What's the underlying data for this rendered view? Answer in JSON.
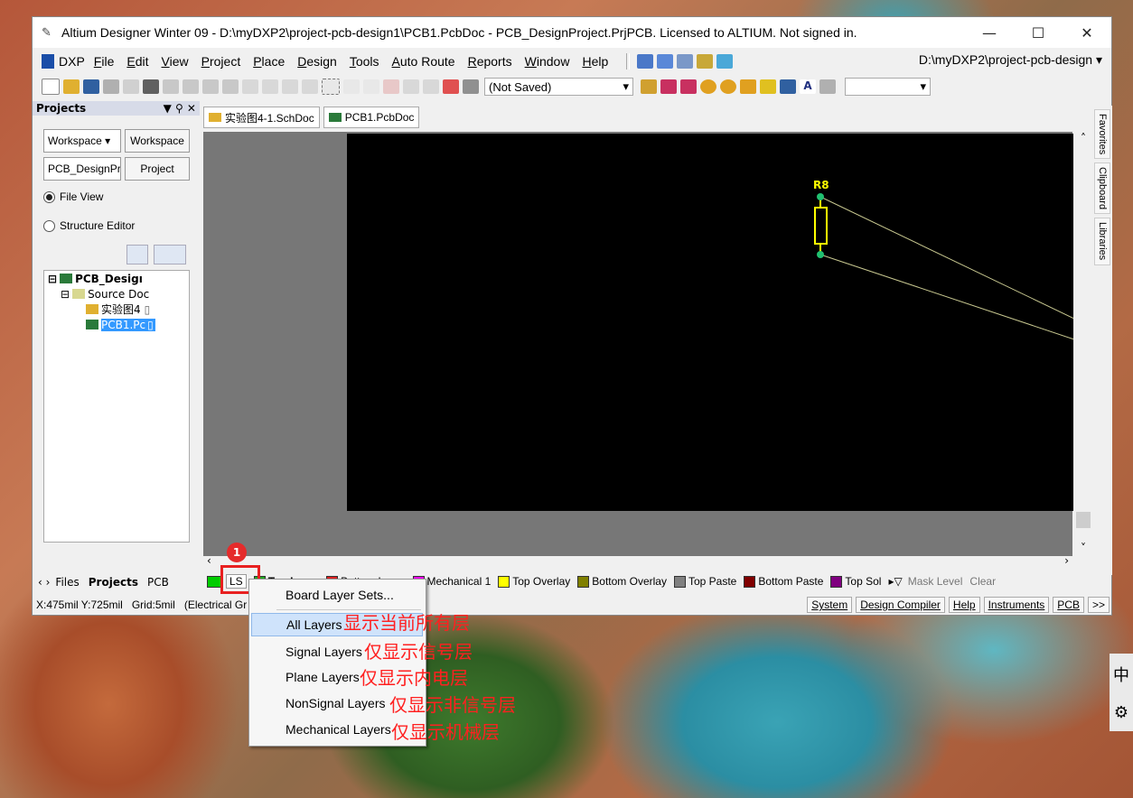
{
  "window": {
    "title": "Altium Designer Winter 09 - D:\\myDXP2\\project-pcb-design1\\PCB1.PcbDoc - PCB_DesignProject.PrjPCB. Licensed to ALTIUM. Not signed in.",
    "minimize": "—",
    "maximize": "☐",
    "close": "✕"
  },
  "menubar": {
    "dxp": "DXP",
    "items": [
      "File",
      "Edit",
      "View",
      "Project",
      "Place",
      "Design",
      "Tools",
      "Auto Route",
      "Reports",
      "Window",
      "Help"
    ],
    "path": "D:\\myDXP2\\project-pcb-design"
  },
  "toolbar": {
    "save_state": "(Not Saved)"
  },
  "projects_panel": {
    "title": "Projects",
    "workspace_combo": "Workspace",
    "workspace_button": "Workspace",
    "project_combo": "PCB_DesignPr(",
    "project_button": "Project",
    "file_view": "File View",
    "structure_editor": "Structure Editor",
    "tree": {
      "project": "PCB_Desigı",
      "source_docs": "Source Doc",
      "sch": "实验图4",
      "pcb": "PCB1.Pc"
    }
  },
  "panel_tabs": [
    "Files",
    "Projects",
    "PCB"
  ],
  "doc_tabs": [
    "实验图4-1.SchDoc",
    "PCB1.PcbDoc"
  ],
  "side_panels": [
    "Favorites",
    "Clipboard",
    "Libraries"
  ],
  "pcb": {
    "component_designator": "R8",
    "colors": {
      "board": "#000000",
      "component": "#ffff00",
      "pad": "#20c070",
      "ratsnest": "#c8c890"
    }
  },
  "layer_bar": {
    "ls_label": "LS",
    "layers": [
      {
        "name": "Top Layer",
        "color": "#22aa22"
      },
      {
        "name": "Bottom Layer",
        "color": "#dd2222"
      },
      {
        "name": "Mechanical 1",
        "color": "#ff00ff"
      },
      {
        "name": "Top Overlay",
        "color": "#ffff00"
      },
      {
        "name": "Bottom Overlay",
        "color": "#808000"
      },
      {
        "name": "Top Paste",
        "color": "#808080"
      },
      {
        "name": "Bottom Paste",
        "color": "#800000"
      },
      {
        "name": "Top Sol",
        "color": "#800080"
      }
    ],
    "mask_level": "Mask Level",
    "clear": "Clear"
  },
  "status_bar": {
    "coords": "X:475mil Y:725mil",
    "grid": "Grid:5mil",
    "mode": "(Electrical Gr",
    "buttons": [
      "System",
      "Design Compiler",
      "Help",
      "Instruments",
      "PCB"
    ],
    "more": ">>"
  },
  "context_menu": {
    "items": [
      "Board Layer Sets...",
      "All Layers",
      "Signal Layers",
      "Plane Layers",
      "NonSignal Layers",
      "Mechanical Layers"
    ]
  },
  "annotations": {
    "badge": "1",
    "all_layers": "显示当前所有层",
    "signal_layers": "仅显示信号层",
    "plane_layers": "仅显示内电层",
    "nonsignal_layers": "仅显示非信号层",
    "mechanical_layers": "仅显示机械层"
  },
  "ime": {
    "lang": "中",
    "settings": "⚙"
  }
}
